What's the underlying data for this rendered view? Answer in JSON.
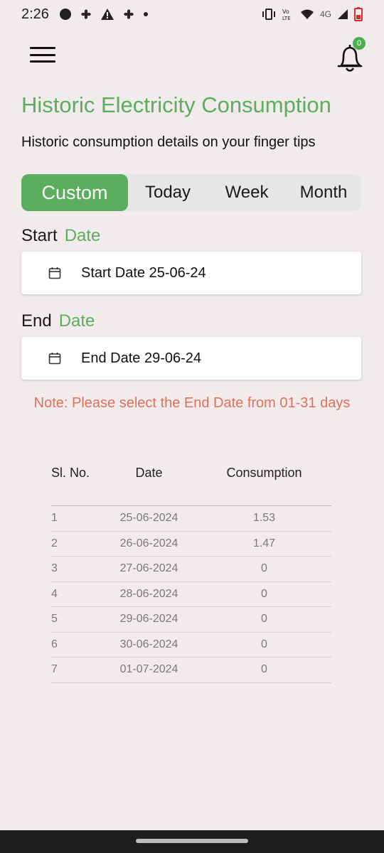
{
  "status_bar": {
    "time": "2:26",
    "network_label": "4G",
    "volte_label": "Vo\nLTE"
  },
  "header": {
    "notification_count": "0"
  },
  "title": "Historic Electricity Consumption",
  "subtitle": "Historic consumption details on your finger tips",
  "tabs": [
    {
      "label": "Custom",
      "active": true
    },
    {
      "label": "Today",
      "active": false
    },
    {
      "label": "Week",
      "active": false
    },
    {
      "label": "Month",
      "active": false
    }
  ],
  "start": {
    "label": "Start",
    "label_accent": "Date",
    "value": "Start Date 25-06-24"
  },
  "end": {
    "label": "End",
    "label_accent": "Date",
    "value": "End Date 29-06-24"
  },
  "note": "Note: Please select the End Date from 01-31 days",
  "table": {
    "headers": [
      "Sl. No.",
      "Date",
      "Consumption"
    ],
    "rows": [
      [
        "1",
        "25-06-2024",
        "1.53"
      ],
      [
        "2",
        "26-06-2024",
        "1.47"
      ],
      [
        "3",
        "27-06-2024",
        "0"
      ],
      [
        "4",
        "28-06-2024",
        "0"
      ],
      [
        "5",
        "29-06-2024",
        "0"
      ],
      [
        "6",
        "30-06-2024",
        "0"
      ],
      [
        "7",
        "01-07-2024",
        "0"
      ]
    ]
  },
  "colors": {
    "accent": "#5cad5e",
    "note": "#e0705a",
    "background": "#f1ebeb"
  },
  "icons": [
    "menu-icon",
    "bell-icon",
    "calendar-icon"
  ]
}
